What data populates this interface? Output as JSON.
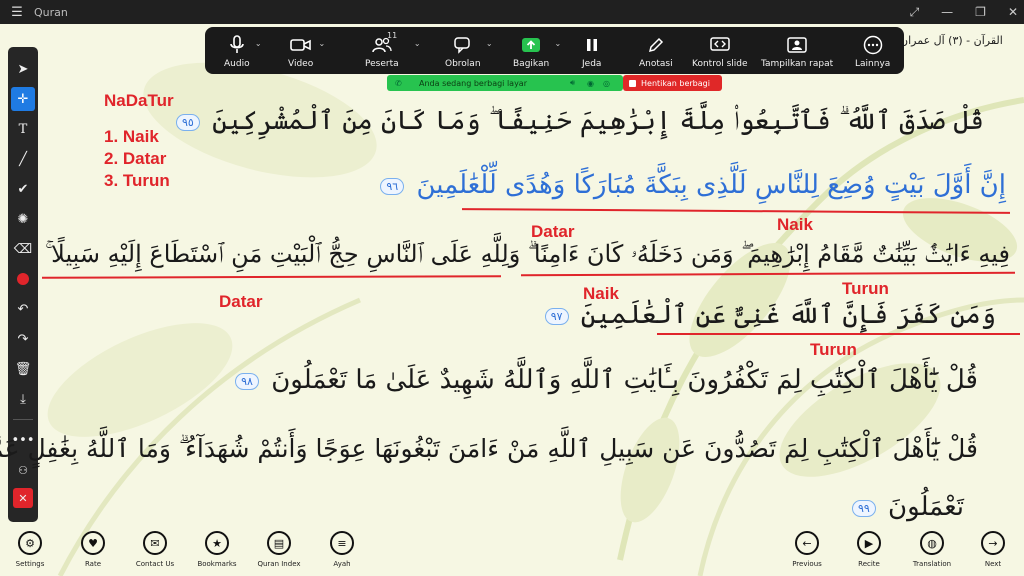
{
  "window": {
    "title": "Quran",
    "menu_icon": "hamburger-icon",
    "controls": [
      "expand-icon",
      "minimize-icon",
      "restore-icon",
      "close-icon"
    ]
  },
  "zoom_toolbar": {
    "items": [
      {
        "label": "Audio",
        "icon": "microphone-icon",
        "has_caret": true
      },
      {
        "label": "Video",
        "icon": "video-camera-icon",
        "has_caret": true
      },
      {
        "label": "Peserta",
        "icon": "participants-icon",
        "count": "11",
        "has_caret": true
      },
      {
        "label": "Obrolan",
        "icon": "chat-icon",
        "has_caret": true
      },
      {
        "label": "Bagikan",
        "icon": "share-screen-icon",
        "has_caret": true
      },
      {
        "label": "Jeda",
        "icon": "pause-icon"
      },
      {
        "label": "Anotasi",
        "icon": "pen-icon"
      },
      {
        "label": "Kontrol slide",
        "icon": "slide-control-icon"
      },
      {
        "label": "Tampilkan rapat",
        "icon": "show-meeting-icon"
      },
      {
        "label": "Lainnya",
        "icon": "more-icon"
      }
    ]
  },
  "share_banner": {
    "text": "Anda sedang berbagi layar",
    "stop_label": "Hentikan berbagi"
  },
  "surah_header": "القرآن - (٣) آل عمران",
  "legend": {
    "title": "NaDaTur",
    "items": [
      "1. Naik",
      "2. Datar",
      "3. Turun"
    ]
  },
  "verses": [
    {
      "text": "قُلْ صَدَقَ ٱللَّهُ ۗ فَٱتَّبِعُوا۟ مِلَّةَ إِبْرَٰهِيمَ حَنِيفًا ۖ وَمَا كَانَ مِنَ ٱلْمُشْرِكِينَ",
      "number": "٩٥"
    },
    {
      "text": "إِنَّ أَوَّلَ بَيْتٍ وُضِعَ لِلنَّاسِ لَلَّذِى بِبَكَّةَ مُبَارَكًا وَهُدًى لِّلْعَٰلَمِينَ",
      "number": "٩٦"
    },
    {
      "text": "فِيهِ ءَايَٰتٌۢ بَيِّنَٰتٌ مَّقَامُ إِبْرَٰهِيمَ ۖ وَمَن دَخَلَهُۥ كَانَ ءَامِنًا ۗ وَلِلَّهِ عَلَى ٱلنَّاسِ حِجُّ ٱلْبَيْتِ مَنِ ٱسْتَطَاعَ إِلَيْهِ سَبِيلًا ۚ"
    },
    {
      "text": "وَمَن كَفَرَ فَإِنَّ ٱللَّهَ غَنِىٌّ عَنِ ٱلْعَٰلَمِينَ",
      "number": "٩٧"
    },
    {
      "text": "قُلْ يَٰٓأَهْلَ ٱلْكِتَٰبِ لِمَ تَكْفُرُونَ بِـَٔايَٰتِ ٱللَّهِ وَٱللَّهُ شَهِيدٌ عَلَىٰ مَا تَعْمَلُونَ",
      "number": "٩٨"
    },
    {
      "text": "قُلْ يَٰٓأَهْلَ ٱلْكِتَٰبِ لِمَ تَصُدُّونَ عَن سَبِيلِ ٱللَّهِ مَنْ ءَامَنَ تَبْغُونَهَا عِوَجًا وَأَنتُمْ شُهَدَآءُ ۗ وَمَا ٱللَّهُ بِغَٰفِلٍ عَمَّا"
    },
    {
      "text": "تَعْمَلُونَ",
      "number": "٩٩"
    }
  ],
  "annotations": {
    "datar_1": "Datar",
    "naik_1": "Naik",
    "datar_2": "Datar",
    "naik_2": "Naik",
    "turun_1": "Turun",
    "turun_2": "Turun",
    "color": "#e0252b"
  },
  "bottom_nav": {
    "left": [
      {
        "label": "Settings",
        "icon": "gear-icon"
      },
      {
        "label": "Rate",
        "icon": "heart-icon"
      },
      {
        "label": "Contact Us",
        "icon": "mail-icon"
      },
      {
        "label": "Bookmarks",
        "icon": "star-icon"
      },
      {
        "label": "Quran Index",
        "icon": "book-icon"
      },
      {
        "label": "Ayah",
        "icon": "list-icon"
      }
    ],
    "right": [
      {
        "label": "Previous",
        "icon": "arrow-left-icon"
      },
      {
        "label": "Recite",
        "icon": "play-icon"
      },
      {
        "label": "Translation",
        "icon": "globe-icon"
      },
      {
        "label": "Next",
        "icon": "arrow-right-icon"
      }
    ]
  },
  "annotation_tools": [
    "select-icon",
    "move-icon",
    "text-icon",
    "draw-line-icon",
    "checkmark-icon",
    "spotlight-icon",
    "eraser-icon",
    "color-icon",
    "undo-icon",
    "redo-icon",
    "trash-icon",
    "save-icon",
    "more-dots-icon",
    "participants-annotate-icon",
    "close-annotation-icon"
  ],
  "colors": {
    "accent_blue": "#2e6fd6",
    "annotation_red": "#e0252b",
    "share_green": "#27c34f",
    "stop_red": "#e02828"
  }
}
